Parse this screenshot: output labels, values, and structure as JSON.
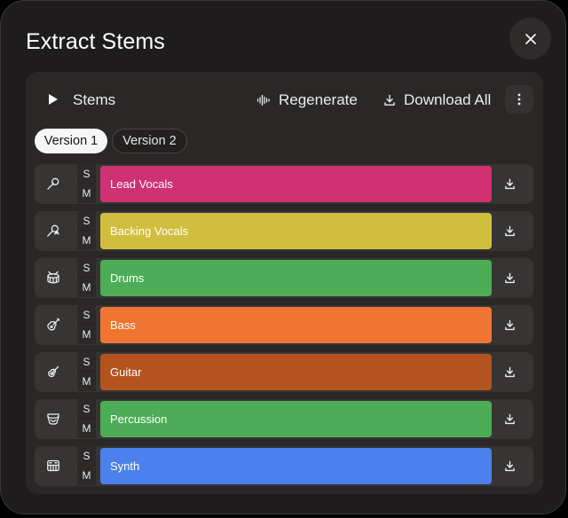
{
  "dialog": {
    "title": "Extract Stems",
    "close_icon": "close-icon"
  },
  "toolbar": {
    "play_icon": "play-icon",
    "label": "Stems",
    "regenerate_label": "Regenerate",
    "regenerate_icon": "waveform-icon",
    "download_all_label": "Download All",
    "download_all_icon": "download-icon",
    "more_icon": "more-vertical-icon"
  },
  "versions": [
    {
      "label": "Version 1",
      "active": true
    },
    {
      "label": "Version 2",
      "active": false
    }
  ],
  "tracks": [
    {
      "name": "Lead Vocals",
      "icon": "microphone-icon",
      "color": "#d03172",
      "solo": "S",
      "mute": "M"
    },
    {
      "name": "Backing Vocals",
      "icon": "microphone-group-icon",
      "color": "#d2be3e",
      "solo": "S",
      "mute": "M"
    },
    {
      "name": "Drums",
      "icon": "drum-icon",
      "color": "#4cad56",
      "solo": "S",
      "mute": "M"
    },
    {
      "name": "Bass",
      "icon": "bass-guitar-icon",
      "color": "#f07532",
      "solo": "S",
      "mute": "M"
    },
    {
      "name": "Guitar",
      "icon": "guitar-icon",
      "color": "#b5531f",
      "solo": "S",
      "mute": "M"
    },
    {
      "name": "Percussion",
      "icon": "percussion-icon",
      "color": "#4cad56",
      "solo": "S",
      "mute": "M"
    },
    {
      "name": "Synth",
      "icon": "keyboard-icon",
      "color": "#4c81ed",
      "solo": "S",
      "mute": "M"
    }
  ]
}
